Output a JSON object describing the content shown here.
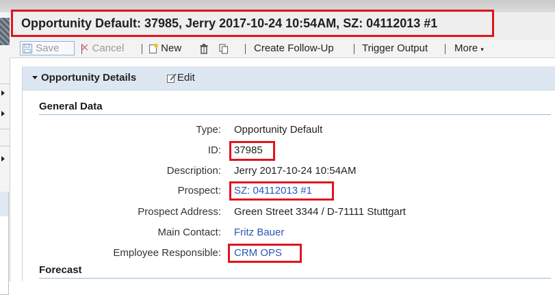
{
  "title": "Opportunity Default: 37985, Jerry 2017-10-24 10:54AM, SZ: 04112013 #1",
  "toolbar": {
    "save": "Save",
    "cancel": "Cancel",
    "new": "New",
    "create_follow_up": "Create Follow-Up",
    "trigger_output": "Trigger Output",
    "more": "More"
  },
  "panel": {
    "title": "Opportunity Details",
    "edit": "Edit"
  },
  "sections": {
    "general": "General Data",
    "forecast": "Forecast"
  },
  "fields": [
    {
      "label": "Type:",
      "value": "Opportunity Default"
    },
    {
      "label": "ID:",
      "value": "37985"
    },
    {
      "label": "Description:",
      "value": "Jerry 2017-10-24 10:54AM"
    },
    {
      "label": "Prospect:",
      "value": "SZ: 04112013 #1"
    },
    {
      "label": "Prospect Address:",
      "value": "Green Street 3344 / D-71111 Stuttgart"
    },
    {
      "label": "Main Contact:",
      "value": "Fritz Bauer"
    },
    {
      "label": "Employee Responsible:",
      "value": "CRM OPS"
    }
  ],
  "colors": {
    "highlight": "#e0141e",
    "link": "#2a55b5",
    "panel_header": "#dde7f2"
  }
}
